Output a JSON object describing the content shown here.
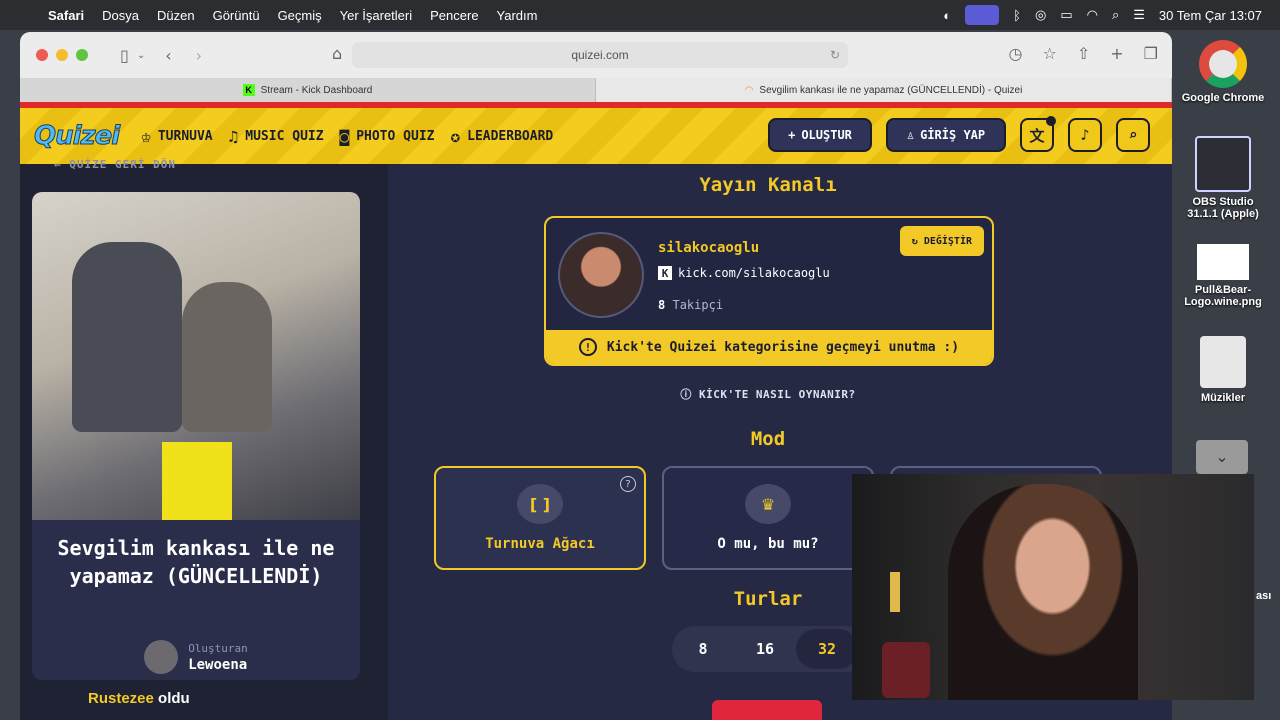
{
  "menubar": {
    "app": "Safari",
    "items": [
      "Dosya",
      "Düzen",
      "Görüntü",
      "Geçmiş",
      "Yer İşaretleri",
      "Pencere",
      "Yardım"
    ],
    "clock": "30 Tem Çar  13:07"
  },
  "desktop": {
    "icons": [
      {
        "label": "Google Chrome"
      },
      {
        "label": "OBS Studio 31.1.1 (Apple)"
      },
      {
        "label": "Pull&Bear-Logo.wine.png"
      },
      {
        "label": "Müzikler"
      }
    ],
    "partial_label": "ası"
  },
  "browser": {
    "url": "quizei.com",
    "tabs": [
      {
        "title": "Stream - Kick Dashboard",
        "active": false
      },
      {
        "title": "Sevgilim kankası ile ne yapamaz (GÜNCELLENDİ) - Quizei",
        "active": true
      }
    ]
  },
  "site": {
    "logo": "Quizei",
    "nav": [
      {
        "label": "TURNUVA",
        "icon": "trophy-icon"
      },
      {
        "label": "MUSIC QUIZ",
        "icon": "music-note-icon"
      },
      {
        "label": "PHOTO QUIZ",
        "icon": "camera-icon"
      },
      {
        "label": "LEADERBOARD",
        "icon": "medal-icon"
      }
    ],
    "create_label": "OLUŞTUR",
    "login_label": "GİRİŞ YAP",
    "colors": {
      "yellow": "#f3c927",
      "navy": "#252944",
      "red": "#e0263c"
    }
  },
  "left": {
    "back_label": "QUİZE GERİ DÖN",
    "quiz_title": "Sevgilim kankası ile ne yapamaz (GÜNCELLENDİ)",
    "creator_caption": "Oluşturan",
    "creator_name": "Lewoena",
    "notice_user": "Rustezee",
    "notice_text": "oldu"
  },
  "channel": {
    "section_title": "Yayın Kanalı",
    "name": "silakocaoglu",
    "link": "kick.com/silakocaoglu",
    "followers_count": "8",
    "followers_label": "Takipçi",
    "change_label": "DEĞİŞTİR",
    "warning": "Kick'te Quizei kategorisine geçmeyi unutma :)",
    "how_to": "KİCK'TE NASIL OYNANIR?"
  },
  "mode": {
    "section_title": "Mod",
    "options": [
      {
        "label": "Turnuva Ağacı",
        "icon": "bracket-icon",
        "active": true
      },
      {
        "label": "O mu, bu mu?",
        "icon": "crown-icon",
        "active": false
      }
    ]
  },
  "rounds": {
    "section_title": "Turlar",
    "options": [
      "8",
      "16",
      "32"
    ],
    "selected": "32"
  }
}
